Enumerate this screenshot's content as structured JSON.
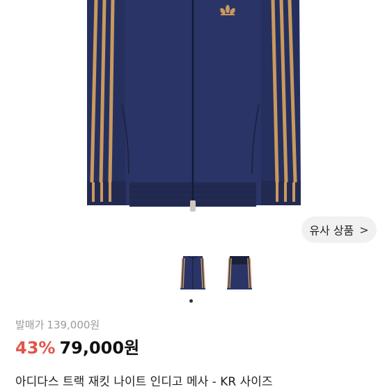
{
  "product": {
    "similar_button_label": "유사 상품",
    "similar_button_chevron": ">",
    "original_price_label": "발매가",
    "original_price": "139,000원",
    "discount": "43%",
    "price": "79,000원",
    "title": "아디다스 트랙 재킷  나이트 인디고 메사 - KR 사이즈"
  },
  "gallery": {
    "thumbnail_count": 2,
    "active_index": 0
  },
  "colors": {
    "jacket_navy": "#2b3466",
    "stripe_tan": "#c9995e",
    "discount_red": "#e1554a"
  },
  "icons": {
    "similar_chevron": "chevron-right-icon",
    "logo": "adidas-trefoil-logo"
  }
}
